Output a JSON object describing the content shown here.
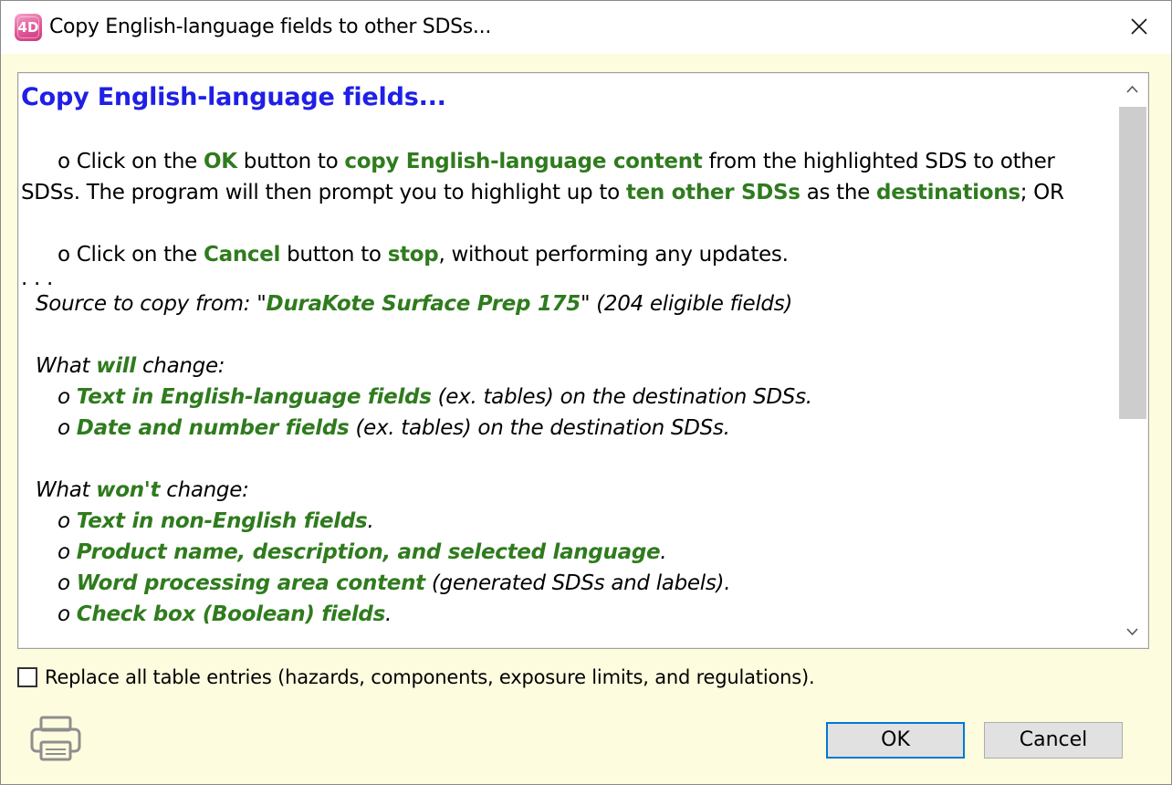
{
  "window": {
    "title": "Copy English-language fields to other SDSs...",
    "app_icon": "4d-app-icon",
    "app_icon_text": "4D",
    "close_icon": "close-icon"
  },
  "message": {
    "heading": "Copy English-language fields...",
    "option_ok": {
      "p1": "o Click on the ",
      "ok": "OK",
      "p2": " button to ",
      "copy": "copy English-language content",
      "p3": " from the highlighted SDS to other",
      "line2a": "SDSs. The program will then prompt you to highlight up to ",
      "ten": "ten other SDSs",
      "p4": " as the ",
      "destinations": "destinations",
      "p5": "; OR"
    },
    "option_cancel": {
      "p1": "o Click on the ",
      "cancel": "Cancel",
      "p2": " button to ",
      "stop": "stop",
      "p3": ", without performing any updates."
    },
    "ellipsis": ". . .",
    "source": {
      "prefix": "Source to copy from: \"",
      "name": "DuraKote Surface Prep 175",
      "suffix": "\" (204 eligible fields)"
    },
    "will_change": {
      "p1": "What ",
      "will": "will",
      "p2": " change:",
      "items": [
        {
          "bullet": "o ",
          "bold": "Text in English-language fields",
          "rest": " (ex. tables) on the destination SDSs."
        },
        {
          "bullet": "o ",
          "bold": "Date and number fields",
          "rest": " (ex. tables) on the destination SDSs."
        }
      ]
    },
    "wont_change": {
      "p1": "What ",
      "wont": "won't",
      "p2": " change:",
      "items": [
        {
          "bullet": "o ",
          "bold": "Text in non-English fields",
          "rest": "."
        },
        {
          "bullet": "o ",
          "bold": "Product name, description, and selected language",
          "rest": "."
        },
        {
          "bullet": "o ",
          "bold": "Word processing area content",
          "rest": " (generated SDSs and labels)."
        },
        {
          "bullet": "o ",
          "bold": "Check box (Boolean) fields",
          "rest": "."
        }
      ]
    }
  },
  "scrollbar": {
    "up_icon": "chevron-up-icon",
    "down_icon": "chevron-down-icon"
  },
  "checkbox": {
    "label": "Replace all table entries (hazards, components, exposure limits, and regulations).",
    "checked": false
  },
  "footer": {
    "print_icon": "printer-icon",
    "ok_label": "OK",
    "cancel_label": "Cancel"
  },
  "colors": {
    "heading": "#1f1fe6",
    "emphasis": "#2f7b1e",
    "dialog_background": "#fefcdf",
    "default_button_border": "#0078d7"
  }
}
